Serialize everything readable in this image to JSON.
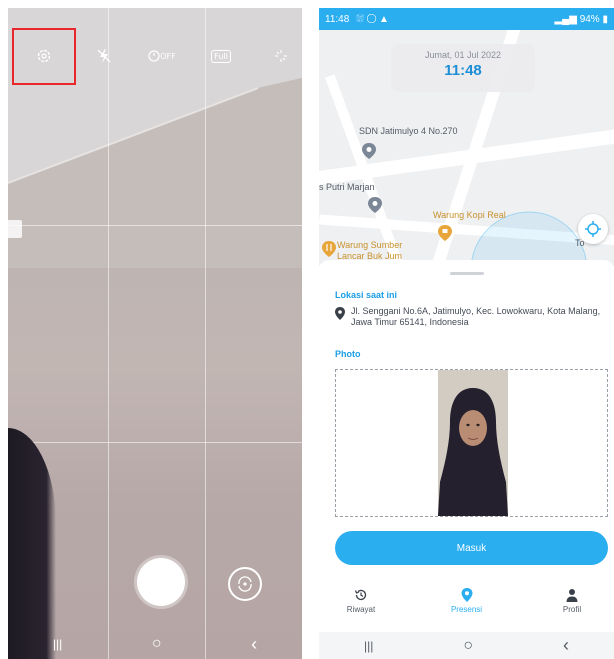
{
  "camera": {
    "toolbar": {
      "settings_icon": "gear-icon",
      "flash_icon": "flash-off-icon",
      "timer_label": "OFF",
      "ratio_label": "Full",
      "effects_icon": "sparkle-icon"
    },
    "highlight_color": "#e8262c",
    "navbar": {
      "recents": "|||",
      "home": "○",
      "back": "‹"
    }
  },
  "app": {
    "statusbar": {
      "time": "11:48",
      "left_icons": "⛆ ◯ ▲",
      "right_text": "94%"
    },
    "map": {
      "date": "Jumat, 01 Jul 2022",
      "clock": "11:48",
      "labels": {
        "school": "SDN Jatimulyo 4 No.270",
        "putri": "s Putri Marjan",
        "warung_kopi": "Warung Kopi Real",
        "warung_sumber_1": "Warung Sumber",
        "warung_sumber_2": "Lancar Buk Jum",
        "toko": "To"
      }
    },
    "sheet": {
      "location_title": "Lokasi saat ini",
      "location_address": "Jl. Senggani No.6A, Jatimulyo, Kec. Lowokwaru, Kota Malang, Jawa Timur 65141, Indonesia",
      "photo_title": "Photo",
      "submit_label": "Masuk"
    },
    "bottom_nav": [
      {
        "label": "Riwayat",
        "icon": "history-icon"
      },
      {
        "label": "Presensi",
        "icon": "location-pin-icon",
        "active": true
      },
      {
        "label": "Profil",
        "icon": "person-icon"
      }
    ],
    "navbar": {
      "recents": "|||",
      "home": "○",
      "back": "‹"
    },
    "accent_color": "#2aaef0"
  }
}
